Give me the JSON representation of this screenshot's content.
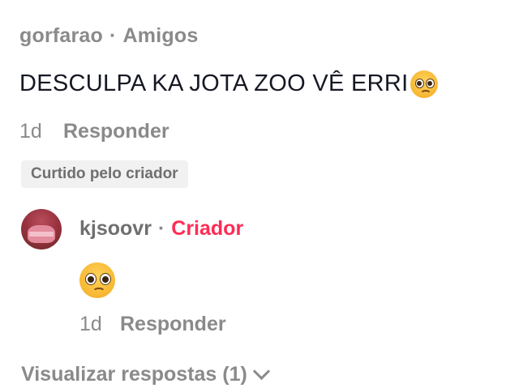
{
  "comment": {
    "author": "gorfarao",
    "separator": "·",
    "relation": "Amigos",
    "text": "DESCULPA KA JOTA ZOO VÊ ERRI",
    "emoji_icon": "pleading-face-emoji",
    "time": "1d",
    "reply_label": "Responder",
    "liked_badge": "Curtido pelo criador"
  },
  "reply": {
    "author": "kjsoovr",
    "separator": "·",
    "role": "Criador",
    "emoji_icon": "pleading-face-emoji",
    "time": "1d",
    "reply_label": "Responder"
  },
  "view_replies": {
    "label": "Visualizar respostas (1)",
    "icon": "chevron-down-icon"
  },
  "colors": {
    "creator_accent": "#fe2c55",
    "muted_text": "#8a8a8a",
    "primary_text": "#161823"
  }
}
